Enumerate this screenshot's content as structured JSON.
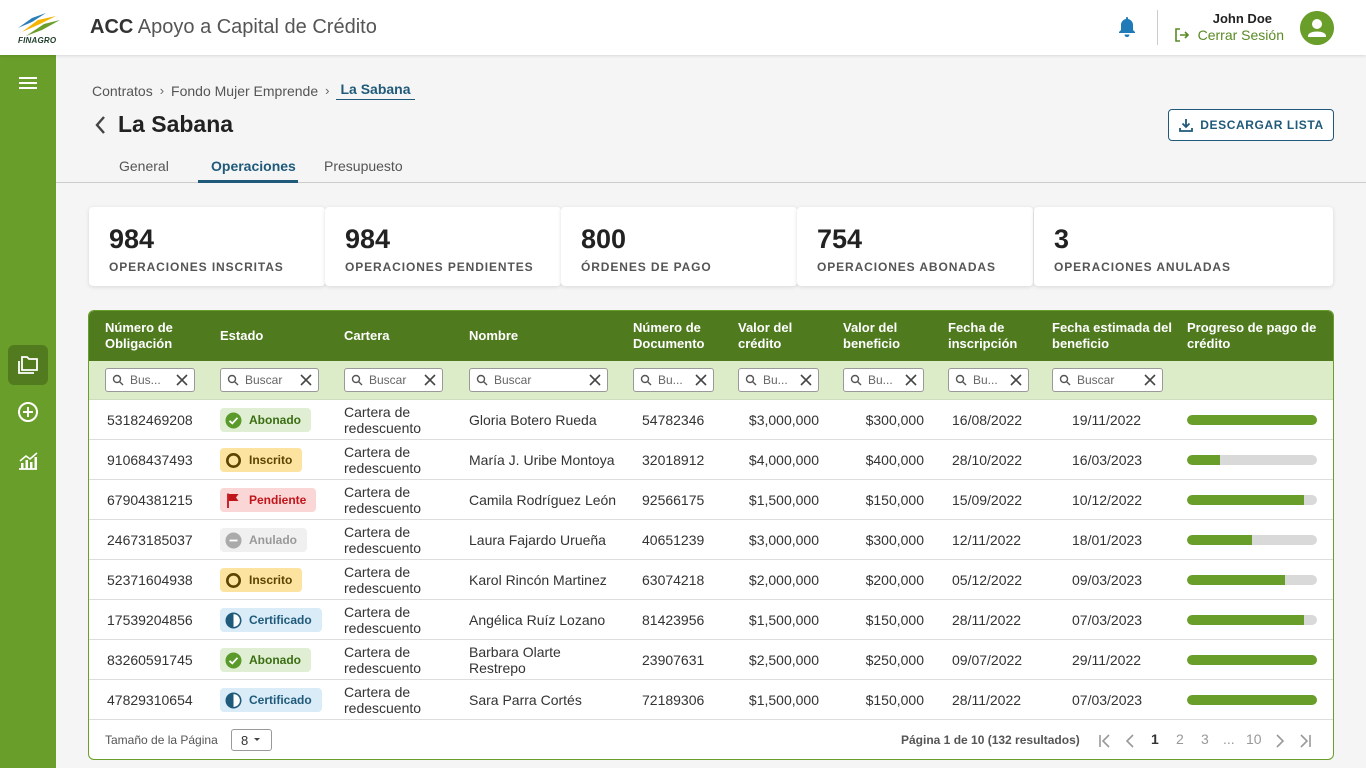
{
  "header": {
    "logo_text": "FINAGRO",
    "app_acronym": "ACC",
    "app_name": "Apoyo a Capital de Crédito",
    "user_name": "John Doe",
    "logout_label": "Cerrar Sesión"
  },
  "sidebar": {
    "items": [
      {
        "icon": "menu-icon"
      },
      {
        "icon": "folders-icon",
        "active": true
      },
      {
        "icon": "add-circle-icon"
      },
      {
        "icon": "chart-icon"
      }
    ]
  },
  "breadcrumb": {
    "items": [
      "Contratos",
      "Fondo Mujer Emprende",
      "La Sabana"
    ]
  },
  "page": {
    "title": "La Sabana",
    "download_label": "DESCARGAR LISTA"
  },
  "tabs": [
    "General",
    "Operaciones",
    "Presupuesto"
  ],
  "active_tab": "Operaciones",
  "stats": [
    {
      "value": "984",
      "label": "OPERACIONES INSCRITAS"
    },
    {
      "value": "984",
      "label": "OPERACIONES PENDIENTES"
    },
    {
      "value": "800",
      "label": "ÓRDENES DE PAGO"
    },
    {
      "value": "754",
      "label": "OPERACIONES ABONADAS"
    },
    {
      "value": "3",
      "label": "OPERACIONES ANULADAS"
    }
  ],
  "table": {
    "columns": [
      "Número de Obligación",
      "Estado",
      "Cartera",
      "Nombre",
      "Número de Documento",
      "Valor del crédito",
      "Valor del beneficio",
      "Fecha de inscripción",
      "Fecha estimada del beneficio",
      "Progreso de pago de crédito"
    ],
    "filters": [
      "Bus...",
      "Buscar",
      "Buscar",
      "Buscar",
      "Bu...",
      "Bu...",
      "Bu...",
      "Bu...",
      "Buscar"
    ],
    "rows": [
      {
        "obligacion": "53182469208",
        "estado": "Abonado",
        "cartera": "Cartera de redescuento",
        "nombre": "Gloria Botero Rueda",
        "documento": "54782346",
        "credito": "$3,000,000",
        "beneficio": "$300,000",
        "inscripcion": "16/08/2022",
        "estimada": "19/11/2022",
        "progreso": 1.0
      },
      {
        "obligacion": "91068437493",
        "estado": "Inscrito",
        "cartera": "Cartera de redescuento",
        "nombre": "María J. Uribe Montoya",
        "documento": "32018912",
        "credito": "$4,000,000",
        "beneficio": "$400,000",
        "inscripcion": "28/10/2022",
        "estimada": "16/03/2023",
        "progreso": 0.25
      },
      {
        "obligacion": "67904381215",
        "estado": "Pendiente",
        "cartera": "Cartera de redescuento",
        "nombre": "Camila Rodríguez León",
        "documento": "92566175",
        "credito": "$1,500,000",
        "beneficio": "$150,000",
        "inscripcion": "15/09/2022",
        "estimada": "10/12/2022",
        "progreso": 0.9
      },
      {
        "obligacion": "24673185037",
        "estado": "Anulado",
        "cartera": "Cartera de redescuento",
        "nombre": "Laura Fajardo Urueña",
        "documento": "40651239",
        "credito": "$3,000,000",
        "beneficio": "$300,000",
        "inscripcion": "12/11/2022",
        "estimada": "18/01/2023",
        "progreso": 0.5
      },
      {
        "obligacion": "52371604938",
        "estado": "Inscrito",
        "cartera": "Cartera de redescuento",
        "nombre": "Karol Rincón Martinez",
        "documento": "63074218",
        "credito": "$2,000,000",
        "beneficio": "$200,000",
        "inscripcion": "05/12/2022",
        "estimada": "09/03/2023",
        "progreso": 0.75
      },
      {
        "obligacion": "17539204856",
        "estado": "Certificado",
        "cartera": "Cartera de redescuento",
        "nombre": "Angélica Ruíz Lozano",
        "documento": "81423956",
        "credito": "$1,500,000",
        "beneficio": "$150,000",
        "inscripcion": "28/11/2022",
        "estimada": "07/03/2023",
        "progreso": 0.9
      },
      {
        "obligacion": "83260591745",
        "estado": "Abonado",
        "cartera": "Cartera de redescuento",
        "nombre": "Barbara Olarte Restrepo",
        "documento": "23907631",
        "credito": "$2,500,000",
        "beneficio": "$250,000",
        "inscripcion": "09/07/2022",
        "estimada": "29/11/2022",
        "progreso": 1.0
      },
      {
        "obligacion": "47829310654",
        "estado": "Certificado",
        "cartera": "Cartera de redescuento",
        "nombre": "Sara Parra Cortés",
        "documento": "72189306",
        "credito": "$1,500,000",
        "beneficio": "$150,000",
        "inscripcion": "28/11/2022",
        "estimada": "07/03/2023",
        "progreso": 1.0
      }
    ]
  },
  "status_styles": {
    "Abonado": {
      "bg": "#e0efd3",
      "color": "#3b6d13",
      "icon": "check-circle-icon"
    },
    "Inscrito": {
      "bg": "#fde3a0",
      "color": "#5c4400",
      "icon": "ring-icon"
    },
    "Pendiente": {
      "bg": "#fbd6d6",
      "color": "#c0151b",
      "icon": "flag-icon"
    },
    "Anulado": {
      "bg": "#f0f0f0",
      "color": "#999999",
      "icon": "minus-circle-icon"
    },
    "Certificado": {
      "bg": "#d9ecf8",
      "color": "#1f5a7a",
      "icon": "half-circle-icon"
    }
  },
  "pagination": {
    "page_size_label": "Tamaño de la Página",
    "page_size": "8",
    "info": "Página 1 de 10 (132 resultados)",
    "pages": [
      "1",
      "2",
      "3",
      "...",
      "10"
    ],
    "current": "1"
  },
  "colors": {
    "brand_green": "#6a9e2a",
    "header_green": "#4f7a1e",
    "accent_blue": "#1f5a7a"
  }
}
